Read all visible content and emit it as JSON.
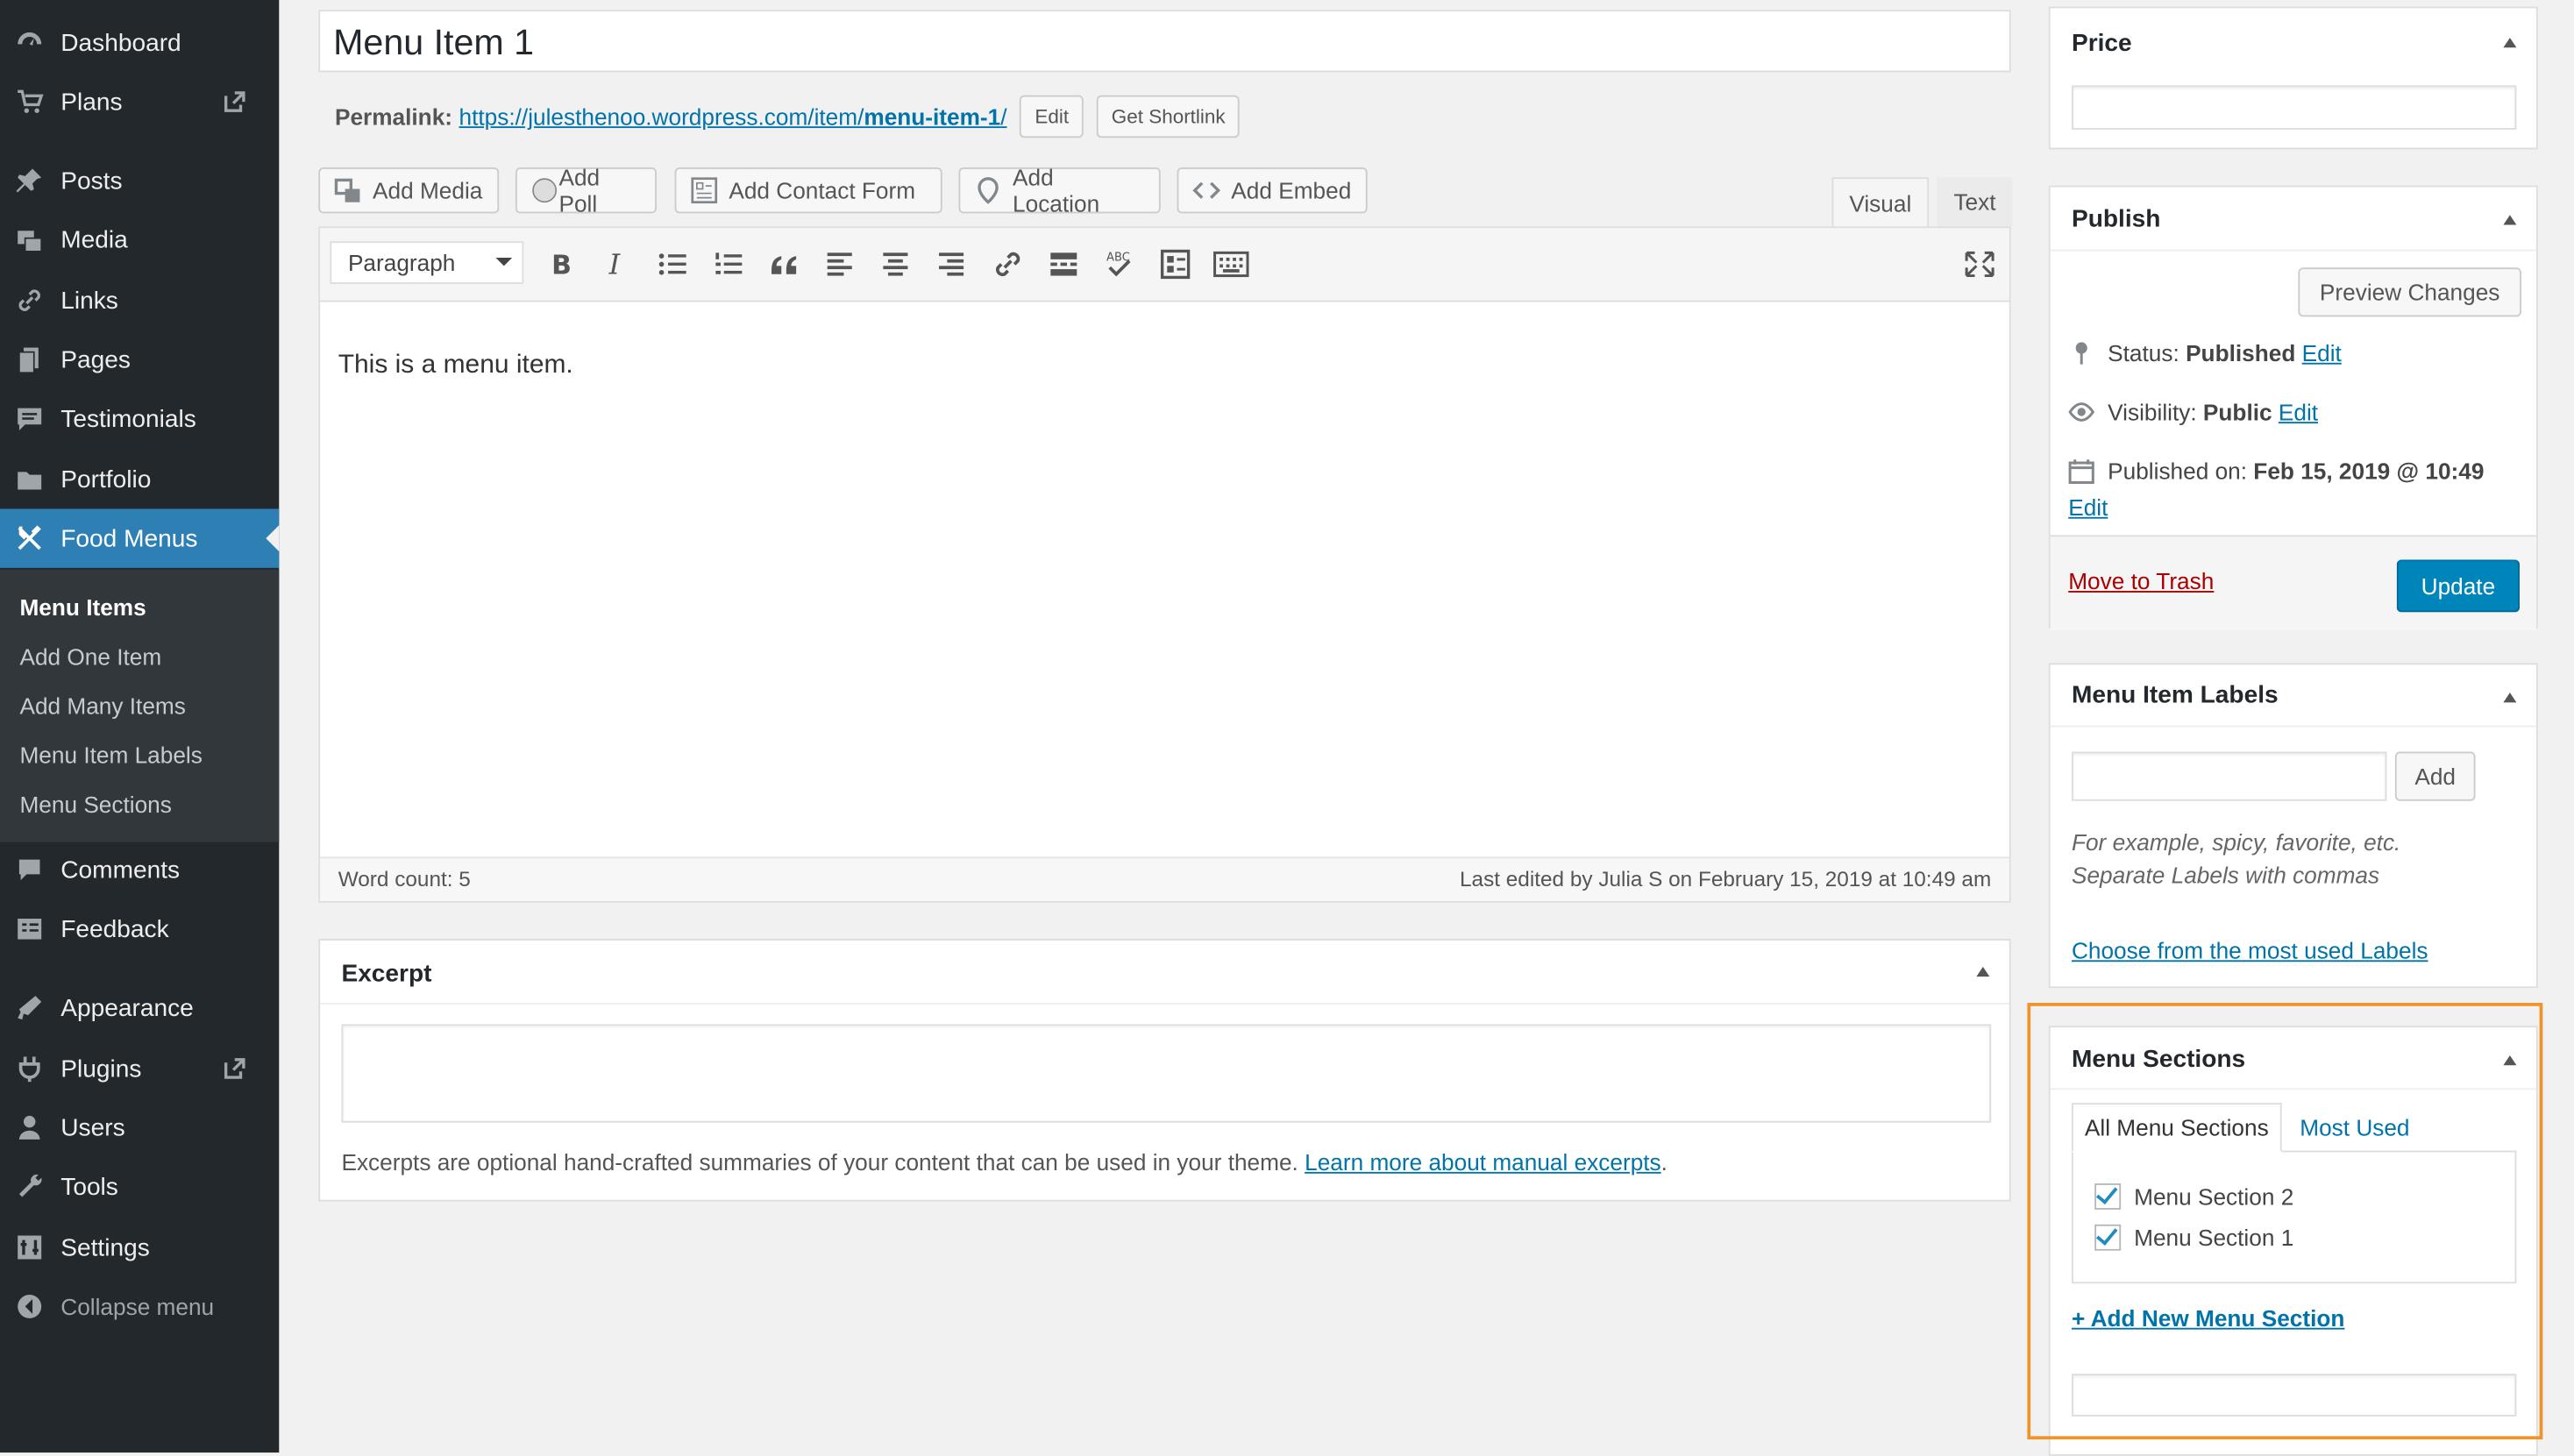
{
  "sidebar": {
    "items": [
      {
        "label": "Dashboard",
        "icon": "dashboard-icon"
      },
      {
        "label": "Plans",
        "icon": "cart-icon",
        "external": true
      },
      {
        "label": "Posts",
        "icon": "pin-icon"
      },
      {
        "label": "Media",
        "icon": "media-icon"
      },
      {
        "label": "Links",
        "icon": "link-icon"
      },
      {
        "label": "Pages",
        "icon": "pages-icon"
      },
      {
        "label": "Testimonials",
        "icon": "testimonial-icon"
      },
      {
        "label": "Portfolio",
        "icon": "portfolio-icon"
      },
      {
        "label": "Food Menus",
        "icon": "food-menus-icon",
        "active": true
      },
      {
        "label": "Comments",
        "icon": "comments-icon"
      },
      {
        "label": "Feedback",
        "icon": "feedback-icon"
      },
      {
        "label": "Appearance",
        "icon": "appearance-icon"
      },
      {
        "label": "Plugins",
        "icon": "plugins-icon",
        "external": true
      },
      {
        "label": "Users",
        "icon": "users-icon"
      },
      {
        "label": "Tools",
        "icon": "tools-icon"
      },
      {
        "label": "Settings",
        "icon": "settings-icon"
      },
      {
        "label": "Collapse menu",
        "icon": "collapse-icon"
      }
    ],
    "submenu": [
      "Menu Items",
      "Add One Item",
      "Add Many Items",
      "Menu Item Labels",
      "Menu Sections"
    ]
  },
  "post": {
    "title": "Menu Item 1",
    "permalink_label": "Permalink:",
    "permalink_base": "https://julesthenoo.wordpress.com/item/",
    "permalink_slug": "menu-item-1",
    "permalink_end": "/",
    "edit": "Edit",
    "shortlink": "Get Shortlink"
  },
  "media_buttons": [
    "Add Media",
    "Add Poll",
    "Add Contact Form",
    "Add Location",
    "Add Embed"
  ],
  "editor": {
    "tab_visual": "Visual",
    "tab_text": "Text",
    "format": "Paragraph",
    "content": "This is a menu item.",
    "word_count": "Word count: 5",
    "last_edited": "Last edited by Julia S on February 15, 2019 at 10:49 am"
  },
  "excerpt": {
    "title": "Excerpt",
    "help": "Excerpts are optional hand-crafted summaries of your content that can be used in your theme.",
    "link": "Learn more about manual excerpts",
    "end": "."
  },
  "price": {
    "title": "Price"
  },
  "publish": {
    "title": "Publish",
    "preview": "Preview Changes",
    "status_label": "Status:",
    "status_value": "Published",
    "visibility_label": "Visibility:",
    "visibility_value": "Public",
    "published_label": "Published on:",
    "published_value": "Feb 15, 2019 @ 10:49",
    "edit": "Edit",
    "trash": "Move to Trash",
    "update": "Update"
  },
  "labels": {
    "title": "Menu Item Labels",
    "add": "Add",
    "hint1": "For example, spicy, favorite, etc.",
    "hint2": "Separate Labels with commas",
    "choose": "Choose from the most used Labels"
  },
  "sections": {
    "title": "Menu Sections",
    "tab_all": "All Menu Sections",
    "tab_used": "Most Used",
    "items": [
      "Menu Section 2",
      "Menu Section 1"
    ],
    "add_new": "+ Add New Menu Section"
  },
  "colors": {
    "highlight": "#f0932b",
    "admin_bar": "#23282d",
    "active": "#2e7fb3",
    "link": "#0073aa",
    "danger": "#a00"
  }
}
